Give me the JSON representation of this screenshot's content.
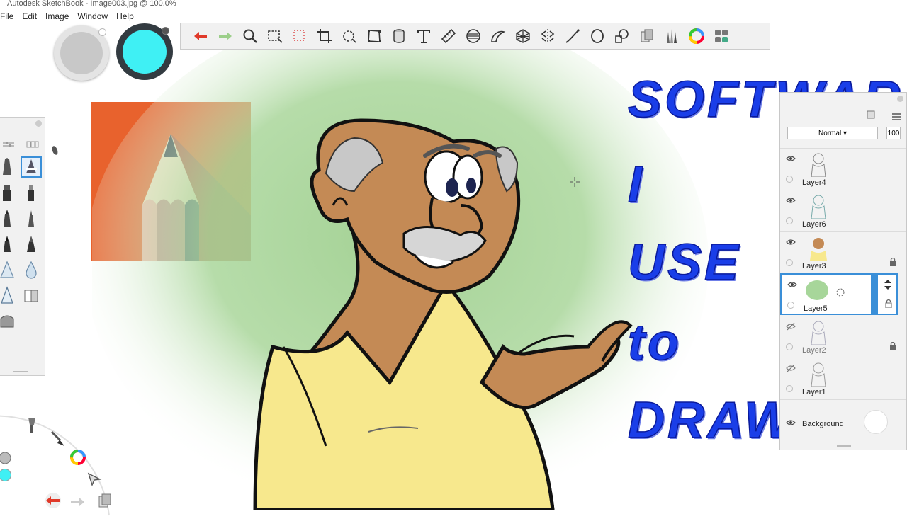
{
  "window": {
    "title": "Autodesk SketchBook - Image003.jpg @ 100.0%"
  },
  "menu": {
    "items": [
      "File",
      "Edit",
      "Image",
      "Window",
      "Help"
    ]
  },
  "colors": {
    "primary_puck": "#c8c8c8",
    "secondary_puck": "#3ff0f4",
    "toolbar_bg": "#f1f1f1",
    "headline": "#1a3ee8",
    "logo_bg": "#e8622d"
  },
  "toolbar": {
    "tools": [
      "undo-icon",
      "redo-icon",
      "zoom-icon",
      "select-rect-icon",
      "select-lasso-icon",
      "crop-icon",
      "transform-icon",
      "distort-icon",
      "fill-icon",
      "text-icon",
      "ruler-icon",
      "ellipse-guide-icon",
      "french-curve-icon",
      "perspective-icon",
      "symmetry-icon",
      "line-icon",
      "ellipse-icon",
      "shape-icon",
      "copy-paste-icon",
      "brush-library-icon",
      "color-wheel-icon",
      "brush-palette-icon"
    ]
  },
  "headline": {
    "line1": "SOFTWARE",
    "line2": "I",
    "line3": "USE",
    "line4": "to",
    "line5": "DRAW"
  },
  "layers": {
    "blend_mode": "Normal",
    "opacity": "100",
    "rows": [
      {
        "name": "Layer4",
        "visible": true,
        "locked": false
      },
      {
        "name": "Layer6",
        "visible": true,
        "locked": false
      },
      {
        "name": "Layer3",
        "visible": true,
        "locked": true
      },
      {
        "name": "Layer5",
        "visible": true,
        "locked": false,
        "selected": true
      },
      {
        "name": "Layer2",
        "visible": false,
        "locked": true
      },
      {
        "name": "Layer1",
        "visible": false,
        "locked": false
      }
    ],
    "background_label": "Background"
  }
}
